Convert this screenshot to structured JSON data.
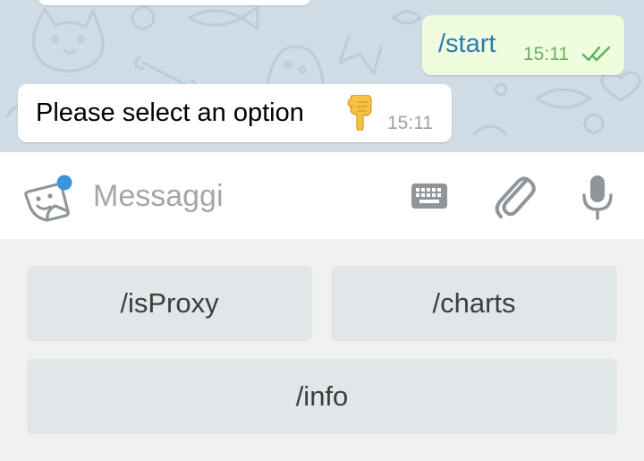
{
  "chat": {
    "messages": [
      {
        "direction": "outgoing",
        "text": "/start",
        "time": "15:11",
        "status_icon": "double-check-icon"
      },
      {
        "direction": "incoming",
        "text": "Please select an option",
        "emoji": "backhand-index-pointing-down",
        "time": "15:11"
      }
    ]
  },
  "input_bar": {
    "placeholder": "Messaggi",
    "value": "",
    "icons": [
      "sticker-icon",
      "keyboard-icon",
      "paperclip-icon",
      "microphone-icon"
    ]
  },
  "bot_keyboard": {
    "rows": [
      [
        {
          "label": "/isProxy"
        },
        {
          "label": "/charts"
        }
      ],
      [
        {
          "label": "/info"
        }
      ]
    ]
  },
  "colors": {
    "chat_background": "#cfdce6",
    "outgoing_bubble": "#effdde",
    "incoming_bubble": "#ffffff",
    "command_text": "#2c7bb6",
    "outgoing_time": "#6aae64",
    "read_ticks": "#5ab25a",
    "incoming_time": "#9aa2a8",
    "keyboard_background": "#f0f0f0",
    "keyboard_button": "#e1e6e8",
    "notification_dot": "#3a95dd",
    "icon_gray": "#8f9599"
  }
}
